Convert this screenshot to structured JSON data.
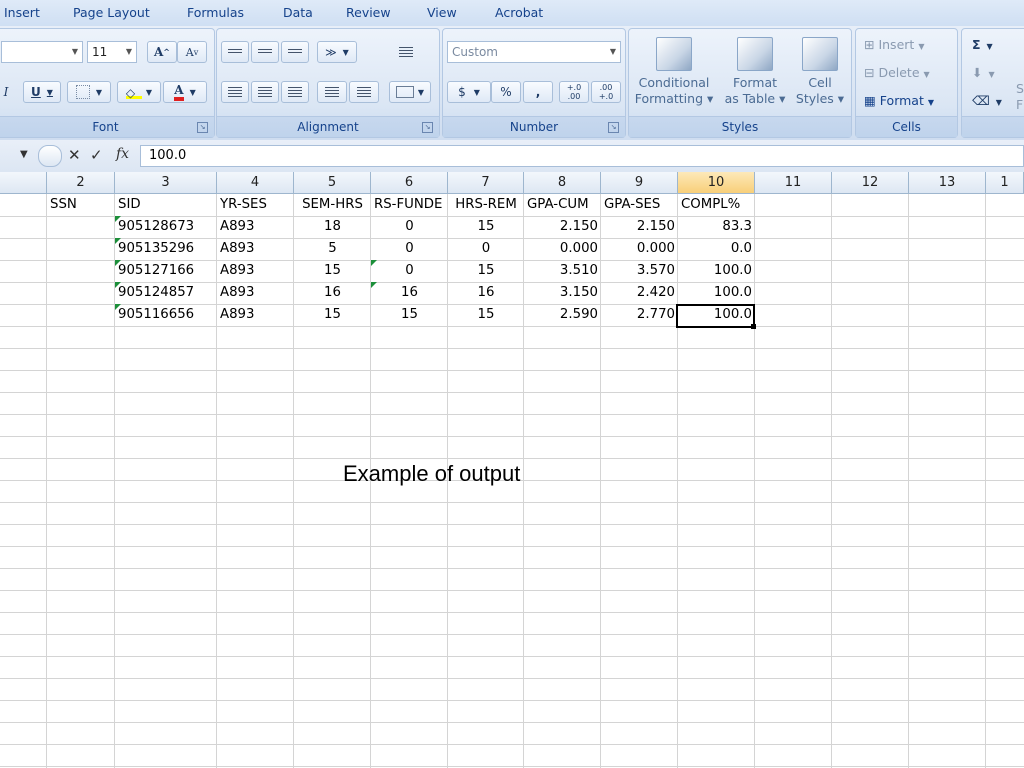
{
  "ribbon_tabs": [
    "Insert",
    "Page Layout",
    "Formulas",
    "Data",
    "Review",
    "View",
    "Acrobat"
  ],
  "font_group": {
    "label": "Font",
    "font_size": "11",
    "grow_label": "A",
    "shrink_label": "A",
    "italic": "I",
    "underline": "U",
    "font_color_label": "A"
  },
  "alignment_group": {
    "label": "Alignment"
  },
  "number_group": {
    "label": "Number",
    "format_value": "Custom",
    "currency": "$",
    "percent": "%",
    "comma": ",",
    "increase_decimal": "+.0 .00",
    "decrease_decimal": ".00 +.0"
  },
  "styles_group": {
    "label": "Styles",
    "conditional": [
      "Conditional",
      "Formatting ▾"
    ],
    "format_table": [
      "Format",
      "as Table ▾"
    ],
    "cell_styles": [
      "Cell",
      "Styles ▾"
    ]
  },
  "cells_group": {
    "label": "Cells",
    "insert": "Insert",
    "delete": "Delete",
    "format": "Format"
  },
  "editing_group": {
    "sigma": "Σ",
    "sort_letter": "S",
    "find_letter": "F"
  },
  "formula_bar": {
    "fx": "fx",
    "value": "100.0"
  },
  "column_headers": [
    "",
    "2",
    "3",
    "4",
    "5",
    "6",
    "7",
    "8",
    "9",
    "10",
    "11",
    "12",
    "13",
    "1"
  ],
  "table": {
    "headers": [
      "SSN",
      "SID",
      "YR-SES",
      "SEM-HRS",
      "RS-FUNDE",
      "HRS-REM",
      "GPA-CUM",
      "GPA-SES",
      "COMPL%"
    ],
    "rows": [
      [
        "",
        "905128673",
        "A893",
        "18",
        "0",
        "15",
        "2.150",
        "2.150",
        "83.3"
      ],
      [
        "",
        "905135296",
        "A893",
        "5",
        "0",
        "0",
        "0.000",
        "0.000",
        "0.0"
      ],
      [
        "",
        "905127166",
        "A893",
        "15",
        "0",
        "15",
        "3.510",
        "3.570",
        "100.0"
      ],
      [
        "",
        "905124857",
        "A893",
        "16",
        "16",
        "16",
        "3.150",
        "2.420",
        "100.0"
      ],
      [
        "",
        "905116656",
        "A893",
        "15",
        "15",
        "15",
        "2.590",
        "2.770",
        "100.0"
      ]
    ]
  },
  "caption": "Example of output"
}
